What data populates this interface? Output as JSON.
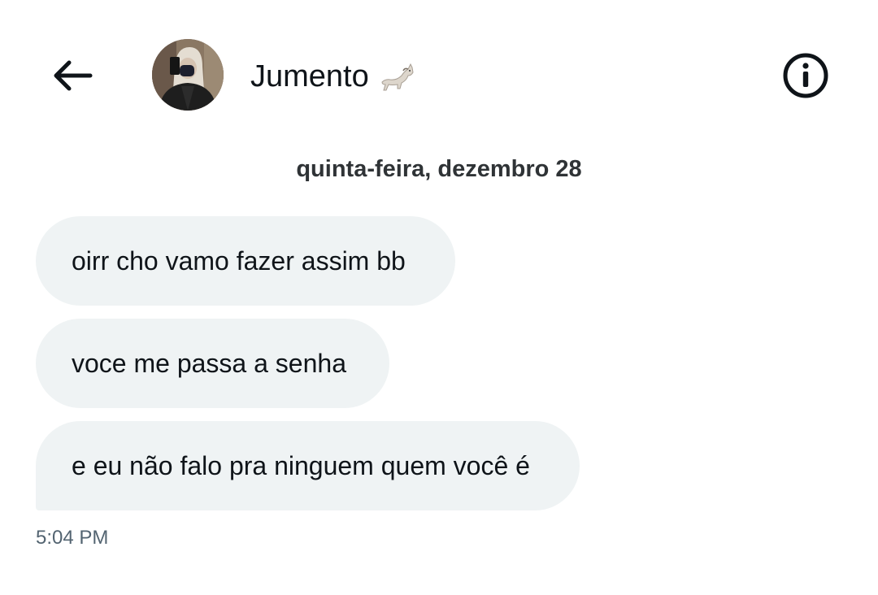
{
  "header": {
    "back_icon": "arrow-left-icon",
    "contact_name": "Jumento",
    "contact_emoji": "horse-emoji-icon",
    "info_icon": "info-circle-icon"
  },
  "conversation": {
    "date_separator": "quinta-feira, dezembro 28",
    "messages": [
      {
        "text": "oirr cho vamo fazer assim bb"
      },
      {
        "text": "voce me passa a senha"
      },
      {
        "text": "e eu não falo pra ninguem quem você é"
      }
    ],
    "last_timestamp": "5:04 PM"
  },
  "colors": {
    "bubble_bg": "#eff3f4",
    "text_primary": "#0f1419",
    "text_secondary": "#536471"
  }
}
